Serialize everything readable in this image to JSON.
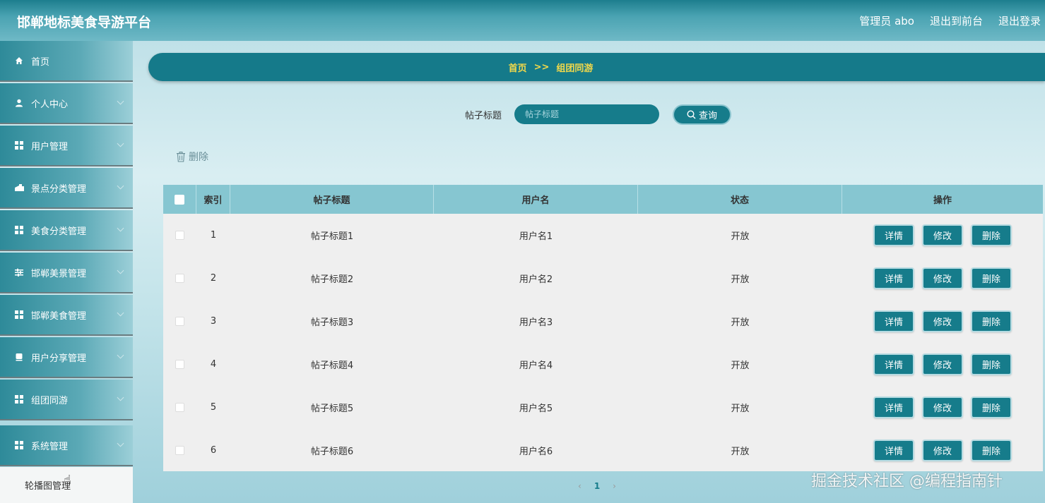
{
  "header": {
    "title": "邯郸地标美食导游平台",
    "user": "管理员 abo",
    "to_front": "退出到前台",
    "logout": "退出登录"
  },
  "sidebar": {
    "items": [
      {
        "label": "首页",
        "icon": "home-icon"
      },
      {
        "label": "个人中心",
        "icon": "user-icon"
      },
      {
        "label": "用户管理",
        "icon": "grid-icon"
      },
      {
        "label": "景点分类管理",
        "icon": "landmark-icon"
      },
      {
        "label": "美食分类管理",
        "icon": "grid-icon"
      },
      {
        "label": "邯郸美景管理",
        "icon": "sliders-icon"
      },
      {
        "label": "邯郸美食管理",
        "icon": "grid-icon"
      },
      {
        "label": "用户分享管理",
        "icon": "card-icon"
      },
      {
        "label": "组团同游",
        "icon": "grid-icon"
      },
      {
        "label": "系统管理",
        "icon": "grid-icon"
      }
    ],
    "sub_item": "轮播图管理"
  },
  "breadcrumb": {
    "home": "首页",
    "sep": ">>",
    "current": "组团同游"
  },
  "search": {
    "label": "帖子标题",
    "placeholder": "帖子标题",
    "button": "查询"
  },
  "toolbar": {
    "delete_label": "删除"
  },
  "table": {
    "headers": [
      "索引",
      "帖子标题",
      "用户名",
      "状态",
      "操作"
    ],
    "rows": [
      {
        "index": "1",
        "title": "帖子标题1",
        "user": "用户名1",
        "status": "开放"
      },
      {
        "index": "2",
        "title": "帖子标题2",
        "user": "用户名2",
        "status": "开放"
      },
      {
        "index": "3",
        "title": "帖子标题3",
        "user": "用户名3",
        "status": "开放"
      },
      {
        "index": "4",
        "title": "帖子标题4",
        "user": "用户名4",
        "status": "开放"
      },
      {
        "index": "5",
        "title": "帖子标题5",
        "user": "用户名5",
        "status": "开放"
      },
      {
        "index": "6",
        "title": "帖子标题6",
        "user": "用户名6",
        "status": "开放"
      }
    ],
    "actions": {
      "detail": "详情",
      "edit": "修改",
      "delete": "删除"
    }
  },
  "pagination": {
    "prev": "‹",
    "current": "1",
    "next": "›"
  },
  "watermark": "掘金技术社区 @编程指南针",
  "colors": {
    "primary": "#167c8b",
    "header_th": "#86c6d1",
    "crumb_text": "#f3d94a"
  }
}
